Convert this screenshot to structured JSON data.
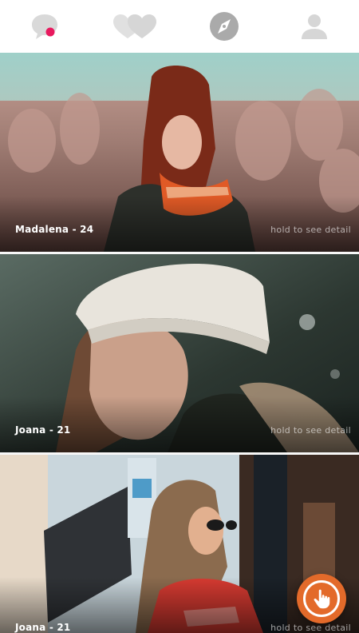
{
  "nav": {
    "items": [
      {
        "icon": "chat-bubble-icon",
        "active": false,
        "has_notification": true
      },
      {
        "icon": "hearts-icon",
        "active": false
      },
      {
        "icon": "compass-icon",
        "active": true
      },
      {
        "icon": "user-profile-icon",
        "active": false
      }
    ],
    "notification_color": "#e8195e"
  },
  "cards": [
    {
      "name": "Madalena - 24",
      "hint": "hold to see detail"
    },
    {
      "name": "Joana - 21",
      "hint": "hold to see detail"
    },
    {
      "name": "Joana - 21",
      "hint": "hold to see detail"
    }
  ],
  "fab": {
    "icon": "touch-hand-icon",
    "color": "#e36a2a"
  }
}
